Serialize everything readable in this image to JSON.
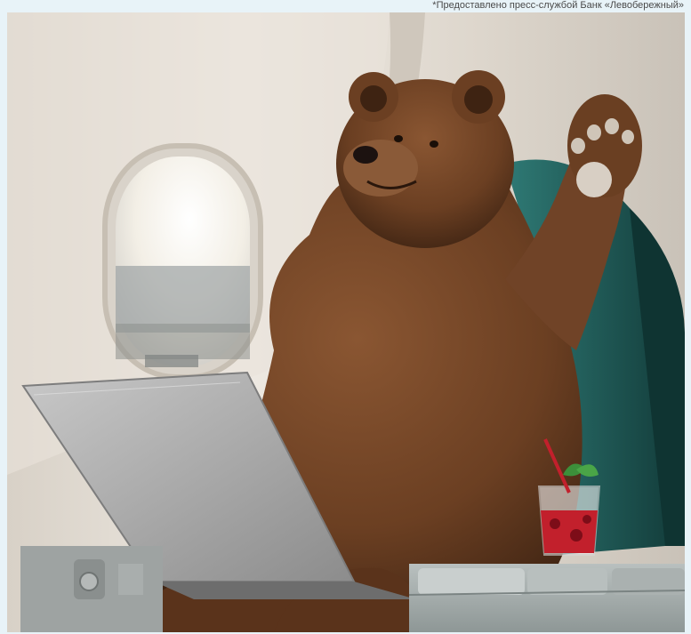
{
  "caption": {
    "credit_text": "*Предоставлено пресс-службой Банк «Левобережный»"
  },
  "photo": {
    "subject": "bear-in-airplane-seat"
  },
  "colors": {
    "page_background": "#e8f3f8",
    "cabin_wall": "#e6e0d8",
    "seat_teal": "#1f5f5c",
    "bear_fur": "#6b3f22",
    "laptop_silver": "#a9a9a9",
    "drink_red": "#c2202c"
  }
}
